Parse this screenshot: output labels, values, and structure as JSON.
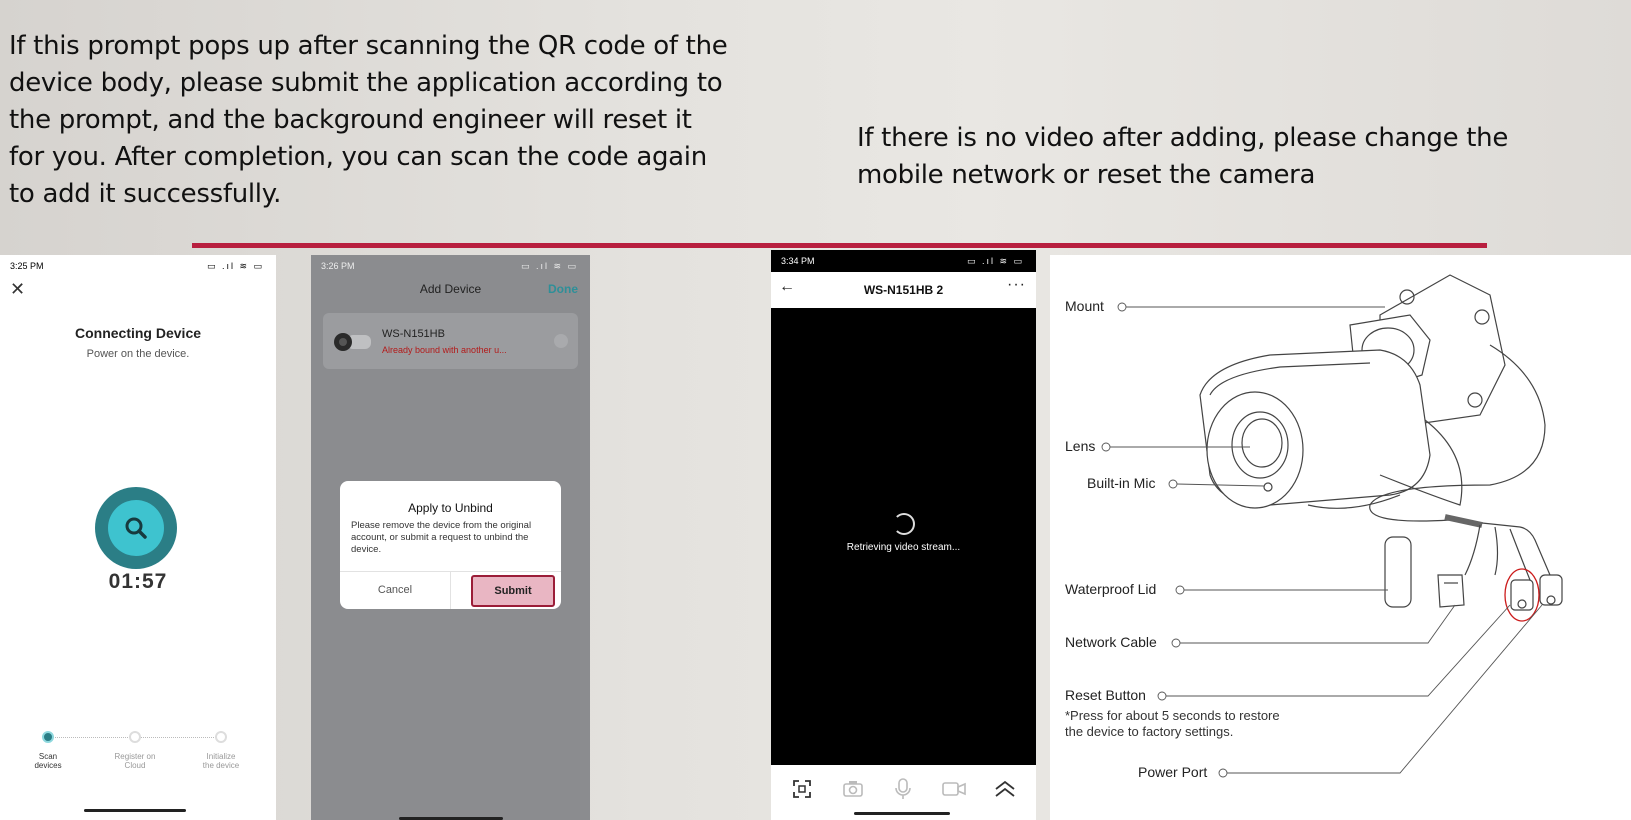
{
  "slide": {
    "left_text": "If this prompt pops up after scanning the QR code of the device body, please submit the application according to the prompt, and the background engineer will reset it for you. After completion, you can scan the code again to add it successfully.",
    "right_text": "If there is no video after adding, please change the mobile network or reset the camera",
    "accent_color": "#b81f3f"
  },
  "phone1": {
    "time": "3:25 PM",
    "status_icons": "▭ .ıl ≋ ▭",
    "title": "Connecting Device",
    "subtitle": "Power on the device.",
    "timer": "01:57",
    "steps": [
      {
        "line1": "Scan",
        "line2": "devices"
      },
      {
        "line1": "Register on",
        "line2": "Cloud"
      },
      {
        "line1": "Initialize",
        "line2": "the device"
      }
    ],
    "accent_color": "#2b7e86"
  },
  "phone2": {
    "time": "3:26 PM",
    "status_icons": "▭ .ıl ≋ ▭",
    "header_title": "Add Device",
    "header_done": "Done",
    "device_name": "WS-N151HB",
    "device_error": "Already bound with another u...",
    "dialog": {
      "title": "Apply to Unbind",
      "body": "Please remove the device from the original account, or submit a request to unbind the device.",
      "cancel": "Cancel",
      "submit": "Submit"
    }
  },
  "phone3": {
    "time": "3:34 PM",
    "status_icons": "▭ .ıl ≋ ▭",
    "title": "WS-N151HB 2",
    "more": "···",
    "video_message": "Retrieving video stream..."
  },
  "diagram": {
    "labels": {
      "mount": "Mount",
      "lens": "Lens",
      "mic": "Built-in Mic",
      "lid": "Waterproof Lid",
      "cable": "Network Cable",
      "reset": "Reset Button",
      "power": "Power Port"
    },
    "footnote_line1": "*Press for about 5 seconds to restore",
    "footnote_line2": "the device to factory settings.",
    "highlight_color": "#cc1b1b"
  }
}
